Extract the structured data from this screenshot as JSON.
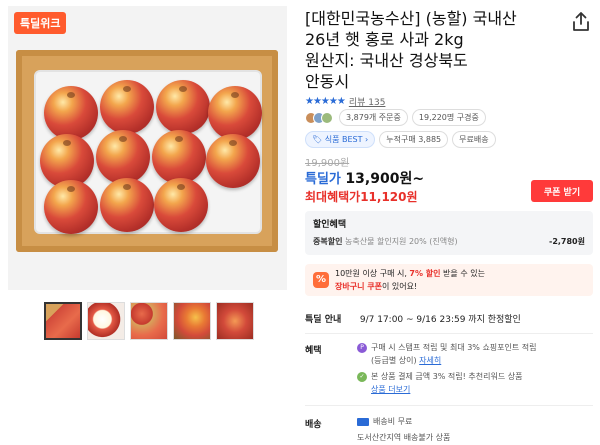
{
  "badge": "특딜위크",
  "product": {
    "title_lines": [
      "[대한민국농수산] (농할) 국내산",
      "26년 햇 홍로 사과 2kg",
      "원산지: 국내산 경상북도",
      "안동시"
    ]
  },
  "rating": {
    "stars": "★★★★★",
    "review_label": "리뷰 135"
  },
  "stats": {
    "orders": "3,879개 주문중",
    "wishlist": "19,220명 구경중"
  },
  "tags": {
    "best": "식품 BEST",
    "cumulative": "누적구매 3,885",
    "free_ship": "무료배송"
  },
  "price": {
    "original": "19,900원",
    "deal_label": "특딜가",
    "deal_amount": "13,900원~",
    "max_benefit_label": "최대혜택가",
    "max_benefit_amount": "11,120원",
    "coupon_button": "쿠폰 받기"
  },
  "discount_box": {
    "title": "할인혜택",
    "item_label": "중복할인",
    "item_desc": "농축산물 할인지원 20% (진액형)",
    "item_amount": "-2,780원"
  },
  "promo": {
    "icon": "%",
    "line1_a": "10만원 이상 구매 시, ",
    "line1_hl": "7% 할인",
    "line1_b": " 받을 수 있는",
    "line2_hl": "장바구니 쿠폰",
    "line2_b": "이 있어요!"
  },
  "special": {
    "label": "특딜 안내",
    "text": "9/7 17:00 ~ 9/16 23:59 까지 한정할인"
  },
  "perks": {
    "label": "혜택",
    "p1_icon": "P",
    "p1_line1": "구매 시 스탬프 적립 및 최대 3% 쇼핑포인트 적립",
    "p1_line2": "(등급별 상이) ",
    "p1_link": "자세히",
    "p2_icon": "✓",
    "p2_line1": "본 상품 결제 금액 3% 적립! 추천리워드 상품",
    "p2_link": "상품 더보기"
  },
  "shipping": {
    "label": "배송",
    "line1": "배송비 무료",
    "line2": "도서산간지역 배송불가 상품"
  }
}
